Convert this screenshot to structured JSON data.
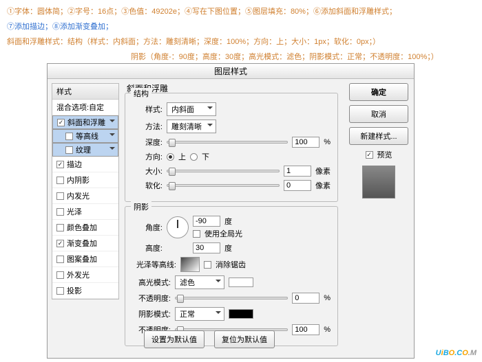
{
  "header": {
    "l1": "①字体：圆体简；②字号：16点；③色值：49202e；④写在下图位置；⑤图层填充：80%；⑥添加斜面和浮雕样式；",
    "l2": "⑦添加描边；⑧添加渐变叠加；",
    "l3a": "斜面和浮雕样式：结构（样式：内斜面；方法：雕刻清晰；深度：100%；方向：上；大小：1px；软化：0px；）",
    "l3b": "阴影（角度-：90度；高度：30度；高光模式：滤色；阴影模式：正常；不透明度：100%；）"
  },
  "dialog": {
    "title": "图层样式",
    "left": {
      "head": "样式",
      "blend": "混合选项:自定",
      "items": [
        "斜面和浮雕",
        "等高线",
        "纹理",
        "描边",
        "内阴影",
        "内发光",
        "光泽",
        "颜色叠加",
        "渐变叠加",
        "图案叠加",
        "外发光",
        "投影"
      ]
    },
    "main": {
      "section": "斜面和浮雕",
      "struct": {
        "label": "结构",
        "style_l": "样式:",
        "style_v": "内斜面",
        "method_l": "方法:",
        "method_v": "雕刻清晰",
        "depth_l": "深度:",
        "depth_v": "100",
        "pct": "%",
        "dir_l": "方向:",
        "up": "上",
        "down": "下",
        "size_l": "大小:",
        "size_v": "1",
        "px": "像素",
        "soft_l": "软化:",
        "soft_v": "0"
      },
      "shadow": {
        "label": "阴影",
        "angle_l": "角度:",
        "angle_v": "-90",
        "deg": "度",
        "global": "使用全局光",
        "alt_l": "高度:",
        "alt_v": "30",
        "gloss_l": "光泽等高线:",
        "anti": "消除锯齿",
        "hi_l": "高光模式:",
        "hi_v": "滤色",
        "op_l": "不透明度:",
        "op1": "0",
        "sh_l": "阴影模式:",
        "sh_v": "正常",
        "op2": "100"
      }
    },
    "right": {
      "ok": "确定",
      "cancel": "取消",
      "new": "新建样式...",
      "preview": "预览"
    },
    "footer": {
      "def": "设置为默认值",
      "reset": "复位为默认值"
    }
  },
  "wm": {
    "u": "U",
    "i": "i",
    "b": "B",
    "o": "O",
    "c": ".C",
    "m": ".M"
  }
}
